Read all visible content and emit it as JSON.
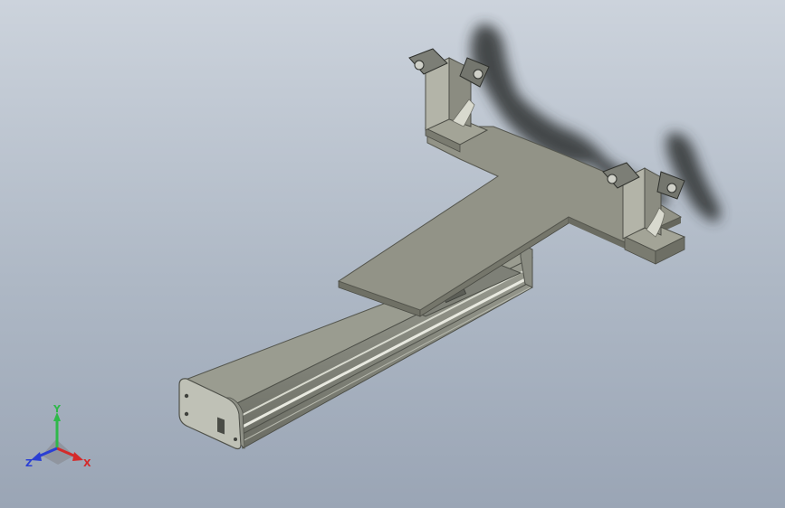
{
  "viewport": {
    "background_top": "#ccd3dc",
    "background_bottom": "#9aa5b5"
  },
  "model": {
    "plate_color": "#8f9082",
    "plate_top_color": "#96968a",
    "plate_edge_color": "#6f7065",
    "rail_color": "#7d7f75",
    "rail_light": "#c9cbc0",
    "shadow_color": "#3a3c3a"
  },
  "triad": {
    "x_label": "X",
    "y_label": "Y",
    "z_label": "Z",
    "x_color": "#d42a2a",
    "y_color": "#2fb84a",
    "z_color": "#2a3fd4"
  }
}
